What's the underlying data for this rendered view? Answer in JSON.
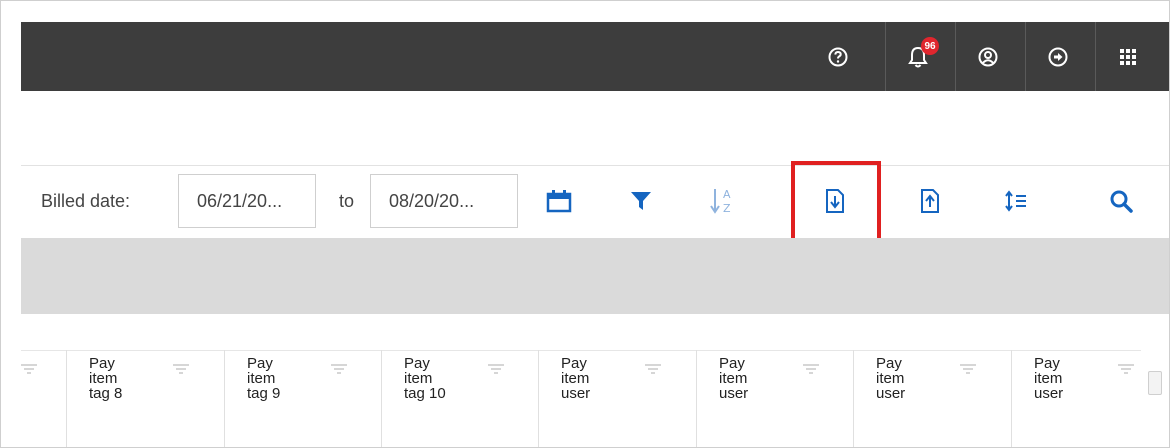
{
  "topbar": {
    "help_icon": "help-circle-icon",
    "notifications_icon": "bell-icon",
    "notifications_count": "96",
    "user_icon": "user-circle-icon",
    "logout_icon": "logout-icon",
    "apps_icon": "grid-apps-icon"
  },
  "toolbar": {
    "billed_label": "Billed date:",
    "from_date": "06/21/20...",
    "to_label": "to",
    "to_date": "08/20/20...",
    "tools": [
      "calendar-icon",
      "filter-icon",
      "sort-az-icon",
      "export-icon",
      "import-icon",
      "row-density-icon",
      "search-icon"
    ]
  },
  "table": {
    "columns": [
      "",
      "Pay\nitem\ntag 8",
      "Pay\nitem\ntag 9",
      "Pay\nitem\ntag 10",
      "Pay\nitem\nuser",
      "Pay\nitem\nuser",
      "Pay\nitem\nuser",
      "Pay\nitem\nuser"
    ]
  },
  "colors": {
    "topbar": "#3d3d3d",
    "accent_blue": "#1565c0",
    "highlight_red": "#e02020",
    "badge_red": "#e0262e"
  }
}
